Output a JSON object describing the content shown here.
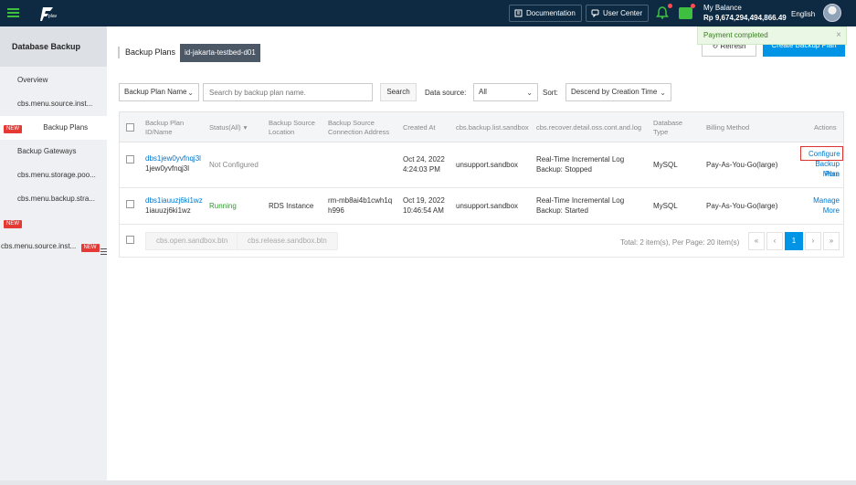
{
  "topbar": {
    "logo_text": "plav",
    "documentation": "Documentation",
    "user_center": "User Center",
    "balance_label": "My Balance",
    "balance_value": "Rp 9,674,294,494,866.49",
    "language": "English"
  },
  "sidebar": {
    "title": "Database Backup",
    "items": [
      {
        "label": "Overview"
      },
      {
        "label": "cbs.menu.source.inst..."
      },
      {
        "label": "Backup Plans",
        "badge": "NEW"
      },
      {
        "label": "Backup Gateways"
      },
      {
        "label": "cbs.menu.storage.poo..."
      },
      {
        "label": "cbs.menu.backup.stra..."
      },
      {
        "label": "",
        "badge": "NEW"
      },
      {
        "label": "cbs.menu.source.inst...",
        "badge": "NEW"
      }
    ]
  },
  "header": {
    "title": "Backup Plans",
    "region": "id-jakarta-testbed-d01",
    "refresh_label": "Refresh",
    "create_label": "Create Backup Plan",
    "toast": "Payment completed",
    "toast_close": "×"
  },
  "filters": {
    "field_select": "Backup Plan Name",
    "search_placeholder": "Search by backup plan name.",
    "search_button": "Search",
    "data_source_label": "Data source:",
    "data_source_value": "All",
    "sort_label": "Sort:",
    "sort_value": "Descend by Creation Time"
  },
  "table": {
    "columns": {
      "plan": "Backup Plan ID/Name",
      "status": "Status(All)",
      "location": "Backup Source Location",
      "conn": "Backup Source Connection Address",
      "created": "Created At",
      "sandbox": "cbs.backup.list.sandbox",
      "recover": "cbs.recover.detail.oss.cont.and.log",
      "dbtype": "Database Type",
      "billing": "Billing Method",
      "actions": "Actions"
    },
    "rows": [
      {
        "id": "dbs1jew0yvfnqj3l",
        "name": "1jew0yvfnqj3l",
        "status": "Not Configured",
        "location": "",
        "conn": "",
        "created_date": "Oct 24, 2022",
        "created_time": "4:24:03 PM",
        "sandbox": "unsupport.sandbox",
        "recover_line1": "Real-Time Incremental Log",
        "recover_line2": "Backup: Stopped",
        "dbtype": "MySQL",
        "billing": "Pay-As-You-Go(large)",
        "action1": "Configure",
        "action2": "Backup Plan",
        "action3": "More"
      },
      {
        "id": "dbs1iauuzj6ki1wz",
        "name": "1iauuzj6ki1wz",
        "status": "Running",
        "location": "RDS Instance",
        "conn_line1": "rm-mb8ai4b1cwh1q",
        "conn_line2": "h996",
        "created_date": "Oct 19, 2022",
        "created_time": "10:46:54 AM",
        "sandbox": "unsupport.sandbox",
        "recover_line1": "Real-Time Incremental Log",
        "recover_line2": "Backup: Started",
        "dbtype": "MySQL",
        "billing": "Pay-As-You-Go(large)",
        "action1": "Manage",
        "action2": "More"
      }
    ],
    "footer": {
      "open_sandbox": "cbs.open.sandbox.btn",
      "release_sandbox": "cbs.release.sandbox.btn",
      "total": "Total: 2 item(s), Per Page: 20 item(s)",
      "page": "1",
      "first": "«",
      "prev": "‹",
      "next": "›",
      "last": "»"
    }
  }
}
